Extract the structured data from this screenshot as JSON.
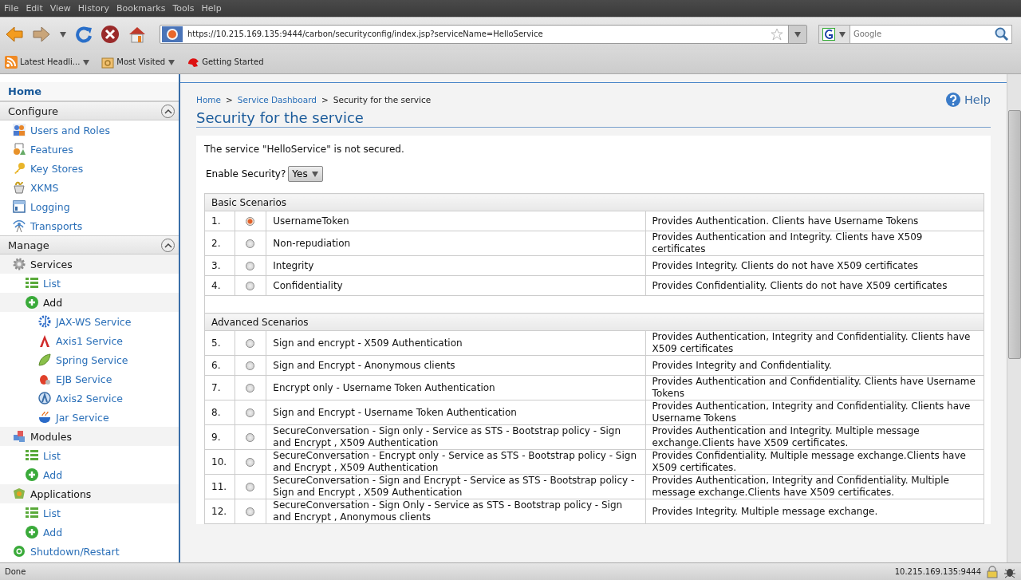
{
  "menu_bar": [
    "File",
    "Edit",
    "View",
    "History",
    "Bookmarks",
    "Tools",
    "Help"
  ],
  "address_bar": {
    "value": "https://10.215.169.135:9444/carbon/securityconfig/index.jsp?serviceName=HelloService"
  },
  "search_field": {
    "placeholder": "Google"
  },
  "bookmarks": [
    {
      "label": "Latest Headli...",
      "dropdown": true
    },
    {
      "label": "Most Visited",
      "dropdown": true
    },
    {
      "label": "Getting Started",
      "dropdown": false
    }
  ],
  "sidebar": {
    "home": "Home",
    "sections": [
      {
        "title": "Configure",
        "expanded": true,
        "items": [
          {
            "label": "Users and Roles"
          },
          {
            "label": "Features"
          },
          {
            "label": "Key Stores"
          },
          {
            "label": "XKMS"
          },
          {
            "label": "Logging"
          },
          {
            "label": "Transports"
          }
        ]
      },
      {
        "title": "Manage",
        "expanded": true,
        "items": [
          {
            "label": "Services",
            "children": [
              {
                "label": "List"
              },
              {
                "label": "Add",
                "children": [
                  {
                    "label": "JAX-WS Service"
                  },
                  {
                    "label": "Axis1 Service"
                  },
                  {
                    "label": "Spring Service"
                  },
                  {
                    "label": "EJB Service"
                  },
                  {
                    "label": "Axis2 Service"
                  },
                  {
                    "label": "Jar Service"
                  }
                ]
              }
            ]
          },
          {
            "label": "Modules",
            "children": [
              {
                "label": "List"
              },
              {
                "label": "Add"
              }
            ]
          },
          {
            "label": "Applications",
            "children": [
              {
                "label": "List"
              },
              {
                "label": "Add"
              }
            ]
          },
          {
            "label": "Shutdown/Restart"
          }
        ]
      }
    ]
  },
  "breadcrumb_separator": ">",
  "breadcrumb": [
    {
      "label": "Home",
      "link": true
    },
    {
      "label": "Service Dashboard",
      "link": true
    },
    {
      "label": "Security for the service",
      "link": false
    }
  ],
  "help": "Help",
  "page_title": "Security for the service",
  "status_message": "The service \"HelloService\" is not secured.",
  "enable_security": {
    "label": "Enable Security?",
    "value": "Yes"
  },
  "scenario_groups": [
    {
      "title": "Basic Scenarios",
      "rows": [
        {
          "number": "1.",
          "name": "UsernameToken",
          "description": "Provides Authentication. Clients have Username Tokens",
          "selected": true
        },
        {
          "number": "2.",
          "name": "Non-repudiation",
          "description": "Provides Authentication and Integrity. Clients have X509 certificates",
          "selected": false
        },
        {
          "number": "3.",
          "name": "Integrity",
          "description": "Provides Integrity. Clients do not have X509 certificates",
          "selected": false
        },
        {
          "number": "4.",
          "name": "Confidentiality",
          "description": "Provides Confidentiality. Clients do not have X509 certificates",
          "selected": false
        }
      ]
    },
    {
      "title": "Advanced Scenarios",
      "rows": [
        {
          "number": "5.",
          "name": "Sign and encrypt - X509 Authentication",
          "description": "Provides Authentication, Integrity and Confidentiality. Clients have X509 certificates",
          "selected": false
        },
        {
          "number": "6.",
          "name": "Sign and Encrypt - Anonymous clients",
          "description": "Provides Integrity and Confidentiality.",
          "selected": false
        },
        {
          "number": "7.",
          "name": "Encrypt only - Username Token Authentication",
          "description": "Provides Authentication and Confidentiality. Clients have Username Tokens",
          "selected": false
        },
        {
          "number": "8.",
          "name": "Sign and Encrypt - Username Token Authentication",
          "description": "Provides Authentication, Integrity and Confidentiality. Clients have Username Tokens",
          "selected": false
        },
        {
          "number": "9.",
          "name": "SecureConversation - Sign only - Service as STS - Bootstrap policy - Sign and Encrypt , X509 Authentication",
          "description": "Provides Authentication and Integrity. Multiple message exchange.Clients have X509 certificates.",
          "selected": false
        },
        {
          "number": "10.",
          "name": "SecureConversation - Encrypt only - Service as STS - Bootstrap policy - Sign and Encrypt , X509 Authentication",
          "description": "Provides Confidentiality. Multiple message exchange.Clients have X509 certificates.",
          "selected": false
        },
        {
          "number": "11.",
          "name": "SecureConversation - Sign and Encrypt - Service as STS - Bootstrap policy - Sign and Encrypt , X509 Authentication",
          "description": "Provides Authentication, Integrity and Confidentiality. Multiple message exchange.Clients have X509 certificates.",
          "selected": false
        },
        {
          "number": "12.",
          "name": "SecureConversation - Sign Only - Service as STS - Bootstrap policy - Sign and Encrypt , Anonymous clients",
          "description": "Provides Integrity. Multiple message exchange.",
          "selected": false
        }
      ]
    }
  ],
  "status_bar": {
    "text": "Done",
    "host": "10.215.169.135:9444"
  }
}
